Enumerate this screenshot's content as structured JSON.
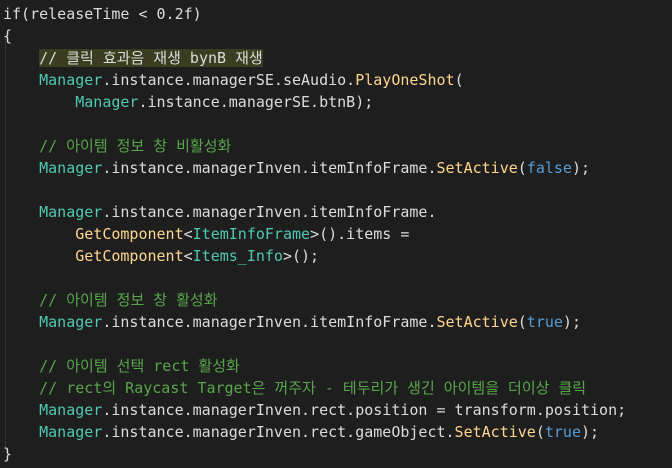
{
  "editor": {
    "lines": [
      {
        "tokens": [
          {
            "t": "if(releaseTime < 0.2f)",
            "k": "default"
          }
        ]
      },
      {
        "tokens": [
          {
            "t": "{",
            "k": "default"
          }
        ]
      },
      {
        "tokens": [
          {
            "t": "    ",
            "k": "default"
          },
          {
            "t": "// 클릭 효과음 재생 bynB 재생",
            "k": "comment-hl"
          }
        ]
      },
      {
        "tokens": [
          {
            "t": "    ",
            "k": "default"
          },
          {
            "t": "Manager",
            "k": "class"
          },
          {
            "t": ".instance.managerSE.seAudio.",
            "k": "default"
          },
          {
            "t": "PlayOneShot",
            "k": "method"
          },
          {
            "t": "(",
            "k": "default"
          }
        ]
      },
      {
        "tokens": [
          {
            "t": "        ",
            "k": "default"
          },
          {
            "t": "Manager",
            "k": "class"
          },
          {
            "t": ".instance.managerSE.btnB);",
            "k": "default"
          }
        ]
      },
      {
        "tokens": []
      },
      {
        "tokens": [
          {
            "t": "    ",
            "k": "default"
          },
          {
            "t": "// 아이템 정보 창 비활성화",
            "k": "comment"
          }
        ]
      },
      {
        "tokens": [
          {
            "t": "    ",
            "k": "default"
          },
          {
            "t": "Manager",
            "k": "class"
          },
          {
            "t": ".instance.managerInven.itemInfoFrame.",
            "k": "default"
          },
          {
            "t": "SetActive",
            "k": "method"
          },
          {
            "t": "(",
            "k": "default"
          },
          {
            "t": "false",
            "k": "keyword"
          },
          {
            "t": ");",
            "k": "default"
          }
        ]
      },
      {
        "tokens": []
      },
      {
        "tokens": [
          {
            "t": "    ",
            "k": "default"
          },
          {
            "t": "Manager",
            "k": "class"
          },
          {
            "t": ".instance.managerInven.itemInfoFrame.",
            "k": "default"
          }
        ]
      },
      {
        "tokens": [
          {
            "t": "        ",
            "k": "default"
          },
          {
            "t": "GetComponent",
            "k": "method"
          },
          {
            "t": "<",
            "k": "default"
          },
          {
            "t": "ItemInfoFrame",
            "k": "class"
          },
          {
            "t": ">().items =",
            "k": "default"
          }
        ]
      },
      {
        "tokens": [
          {
            "t": "        ",
            "k": "default"
          },
          {
            "t": "GetComponent",
            "k": "method"
          },
          {
            "t": "<",
            "k": "default"
          },
          {
            "t": "Items_Info",
            "k": "class"
          },
          {
            "t": ">();",
            "k": "default"
          }
        ]
      },
      {
        "tokens": []
      },
      {
        "tokens": [
          {
            "t": "    ",
            "k": "default"
          },
          {
            "t": "// 아이템 정보 창 활성화",
            "k": "comment"
          }
        ]
      },
      {
        "tokens": [
          {
            "t": "    ",
            "k": "default"
          },
          {
            "t": "Manager",
            "k": "class"
          },
          {
            "t": ".instance.managerInven.itemInfoFrame.",
            "k": "default"
          },
          {
            "t": "SetActive",
            "k": "method"
          },
          {
            "t": "(",
            "k": "default"
          },
          {
            "t": "true",
            "k": "keyword"
          },
          {
            "t": ");",
            "k": "default"
          }
        ]
      },
      {
        "tokens": []
      },
      {
        "tokens": [
          {
            "t": "    ",
            "k": "default"
          },
          {
            "t": "// 아이템 선택 rect 활성화",
            "k": "comment"
          }
        ]
      },
      {
        "tokens": [
          {
            "t": "    ",
            "k": "default"
          },
          {
            "t": "// rect의 Raycast Target은 꺼주자 - 테두리가 생긴 아이템을 더이상 클릭",
            "k": "comment"
          }
        ]
      },
      {
        "tokens": [
          {
            "t": "    ",
            "k": "default"
          },
          {
            "t": "Manager",
            "k": "class"
          },
          {
            "t": ".instance.managerInven.rect.position = transform.position;",
            "k": "default"
          }
        ]
      },
      {
        "tokens": [
          {
            "t": "    ",
            "k": "default"
          },
          {
            "t": "Manager",
            "k": "class"
          },
          {
            "t": ".instance.managerInven.rect.gameObject.",
            "k": "default"
          },
          {
            "t": "SetActive",
            "k": "method"
          },
          {
            "t": "(",
            "k": "default"
          },
          {
            "t": "true",
            "k": "keyword"
          },
          {
            "t": ");",
            "k": "default"
          }
        ]
      },
      {
        "tokens": [
          {
            "t": "}",
            "k": "default"
          }
        ]
      }
    ]
  }
}
